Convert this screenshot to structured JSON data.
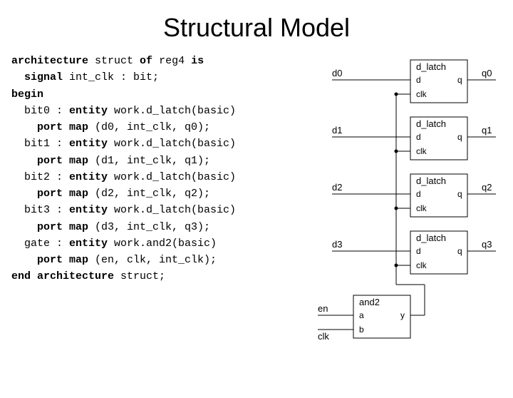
{
  "title": "Structural Model",
  "code": {
    "l1a": "architecture",
    "l1b": " struct ",
    "l1c": "of",
    "l1d": " reg4 ",
    "l1e": "is",
    "l2a": "  signal",
    "l2b": " int_clk : bit;",
    "l3": "begin",
    "l4a": "  bit0 : ",
    "l4b": "entity",
    "l4c": " work.d_latch(basic)",
    "l5a": "    port map",
    "l5b": " (d0, int_clk, q0);",
    "l6a": "  bit1 : ",
    "l6b": "entity",
    "l6c": " work.d_latch(basic)",
    "l7a": "    port map",
    "l7b": " (d1, int_clk, q1);",
    "l8a": "  bit2 : ",
    "l8b": "entity",
    "l8c": " work.d_latch(basic)",
    "l9a": "    port map",
    "l9b": " (d2, int_clk, q2);",
    "l10a": "  bit3 : ",
    "l10b": "entity",
    "l10c": " work.d_latch(basic)",
    "l11a": "    port map",
    "l11b": " (d3, int_clk, q3);",
    "l12a": "  gate : ",
    "l12b": "entity",
    "l12c": " work.and2(basic)",
    "l13a": "    port map",
    "l13b": " (en, clk, int_clk);",
    "l14a": "end architecture",
    "l14b": " struct;"
  },
  "diagram": {
    "inputs": [
      "d0",
      "d1",
      "d2",
      "d3"
    ],
    "outputs": [
      "q0",
      "q1",
      "q2",
      "q3"
    ],
    "latch_label": "d_latch",
    "latch_d": "d",
    "latch_q": "q",
    "latch_clk": "clk",
    "and_label": "and2",
    "and_a": "a",
    "and_b": "b",
    "and_y": "y",
    "en": "en",
    "clk": "clk"
  }
}
